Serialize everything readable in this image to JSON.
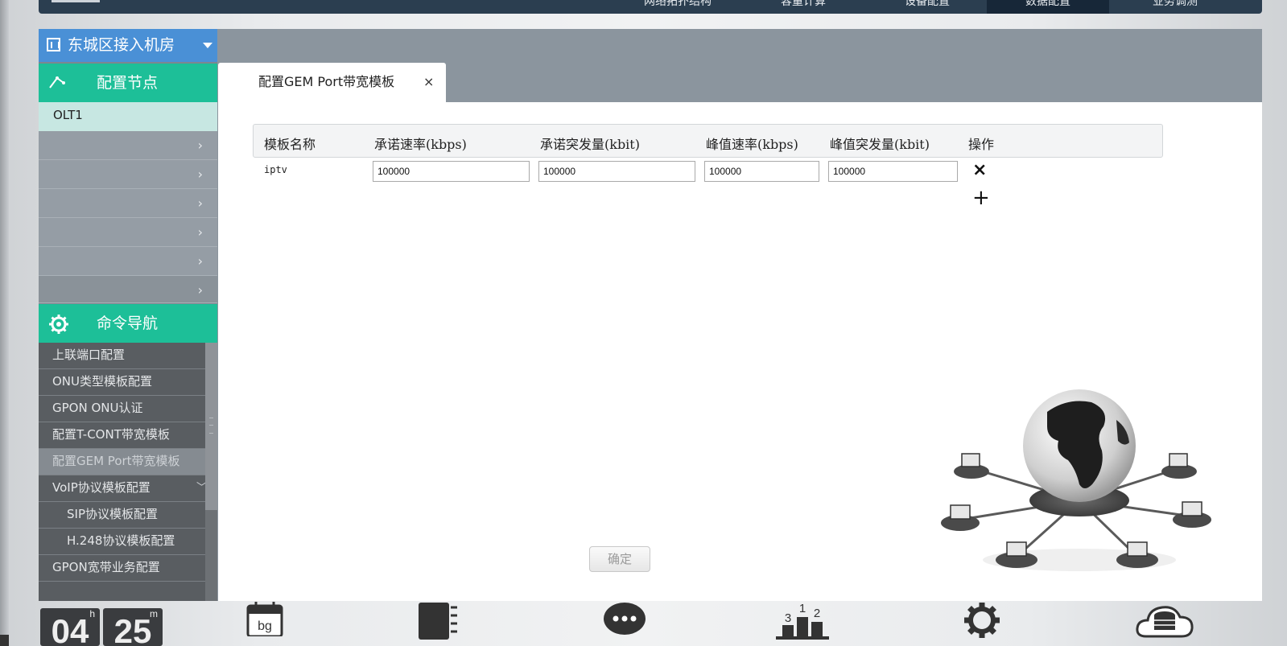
{
  "top_nav": {
    "items": [
      "网络拓扑结构",
      "容量计算",
      "设备配置",
      "数据配置",
      "业务调测"
    ],
    "active": "数据配置"
  },
  "sidebar": {
    "room": "东城区接入机房",
    "config_node_title": "配置节点",
    "olt_item": "OLT1",
    "command_nav_title": "命令导航",
    "commands": [
      "上联端口配置",
      "ONU类型模板配置",
      "GPON ONU认证",
      "配置T-CONT带宽模板",
      "配置GEM Port带宽模板",
      "VoIP协议模板配置",
      "SIP协议模板配置",
      "H.248协议模板配置",
      "GPON宽带业务配置"
    ],
    "active_command": "配置GEM Port带宽模板"
  },
  "tab": {
    "title": "配置GEM Port带宽模板",
    "close": "×"
  },
  "table": {
    "headers": [
      "模板名称",
      "承诺速率(kbps)",
      "承诺突发量(kbit)",
      "峰值速率(kbps)",
      "峰值突发量(kbit)",
      "操作"
    ],
    "rows": [
      {
        "name": "iptv",
        "values": [
          "100000",
          "100000",
          "100000",
          "100000"
        ]
      }
    ],
    "delete_symbol": "×",
    "add_symbol": "+"
  },
  "confirm_button": "确定",
  "dock": {
    "clock": {
      "hours": "04",
      "minutes": "25",
      "h_unit": "h",
      "m_unit": "m"
    },
    "calendar_label": "bg",
    "ranking_numbers": [
      "3",
      "1",
      "2"
    ],
    "icons": [
      "clock-widget",
      "calendar-icon",
      "notebook-icon",
      "chat-icon",
      "ranking-icon",
      "settings-icon",
      "cloud-database-icon"
    ]
  },
  "colors": {
    "accent_green": "#1dbf98",
    "room_blue": "#4a90d6",
    "nav_dark": "#2b3e50",
    "nav_active": "#172738"
  }
}
